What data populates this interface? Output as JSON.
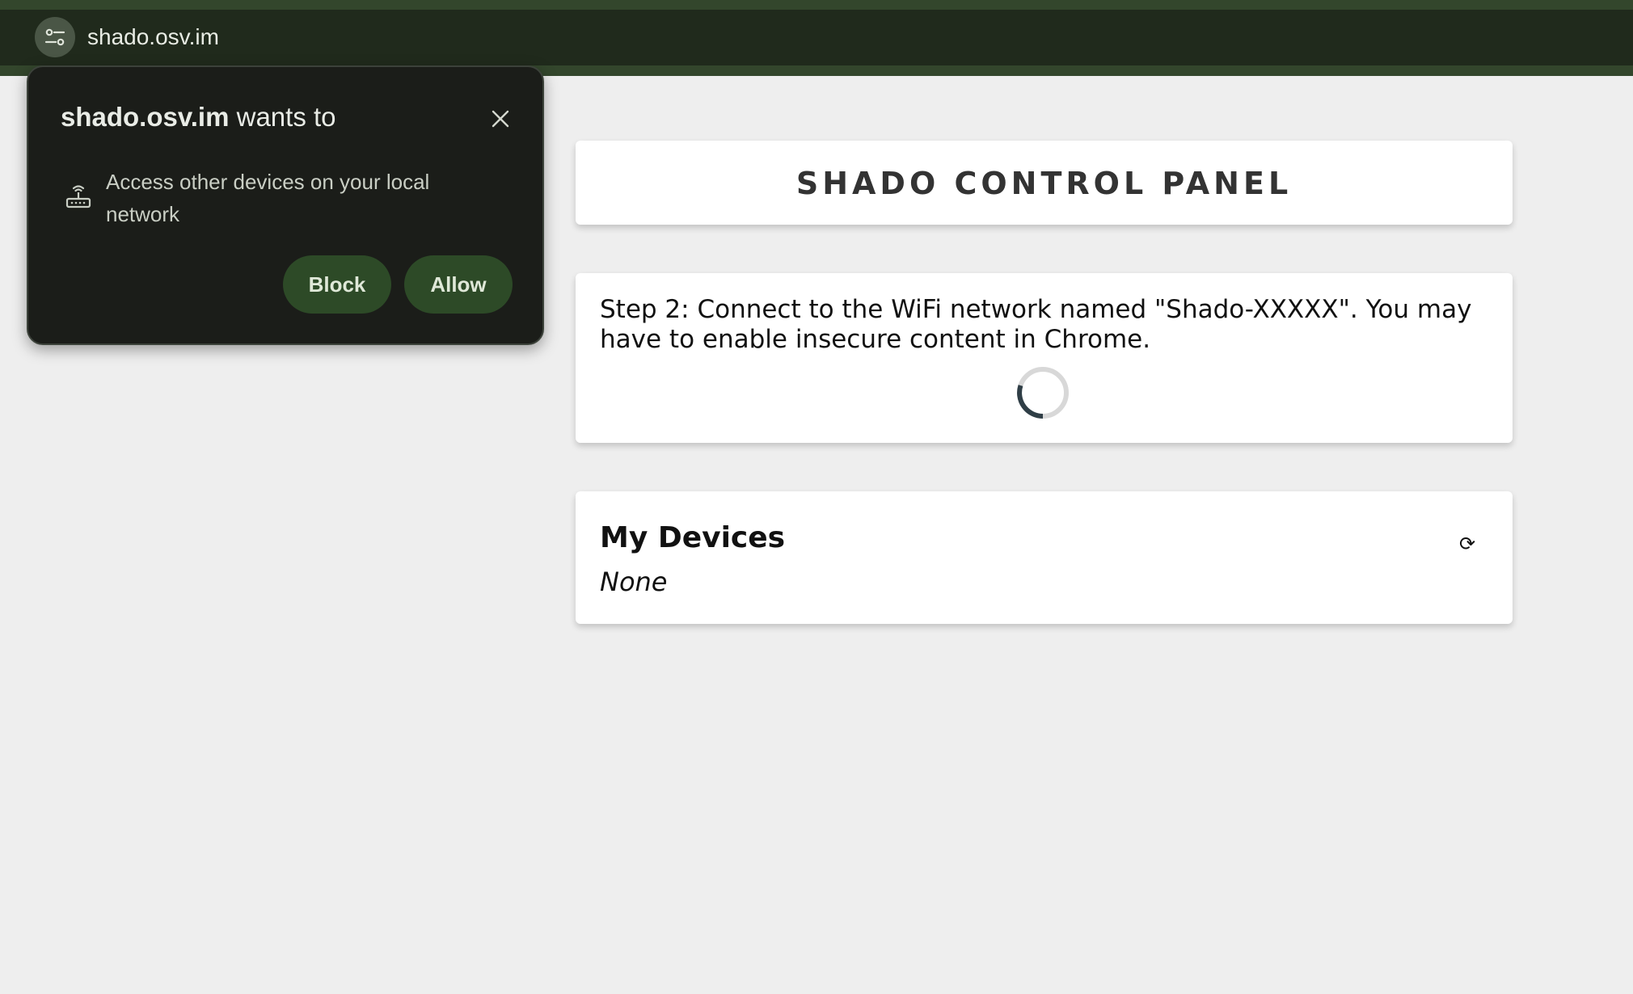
{
  "browser": {
    "url": "shado.osv.im",
    "site_info_icon": "tune-icon"
  },
  "permission_popup": {
    "site": "shado.osv.im",
    "title_suffix": " wants to",
    "permission_text": "Access other devices on your local network",
    "permission_icon": "router-icon",
    "block_label": "Block",
    "allow_label": "Allow",
    "close_icon": "close-icon"
  },
  "page": {
    "title": "SHADO CONTROL PANEL",
    "step_text": "Step 2: Connect to the WiFi network named \"Shado-XXXXX\". You may have to enable insecure content in Chrome.",
    "devices_heading": "My Devices",
    "devices_empty": "None",
    "refresh_glyph": "⟳"
  },
  "colors": {
    "page_background": "#eeeeee",
    "toolbar": "#202a1c",
    "popup_background": "#1b1d19",
    "popup_button": "#2d4a27"
  }
}
